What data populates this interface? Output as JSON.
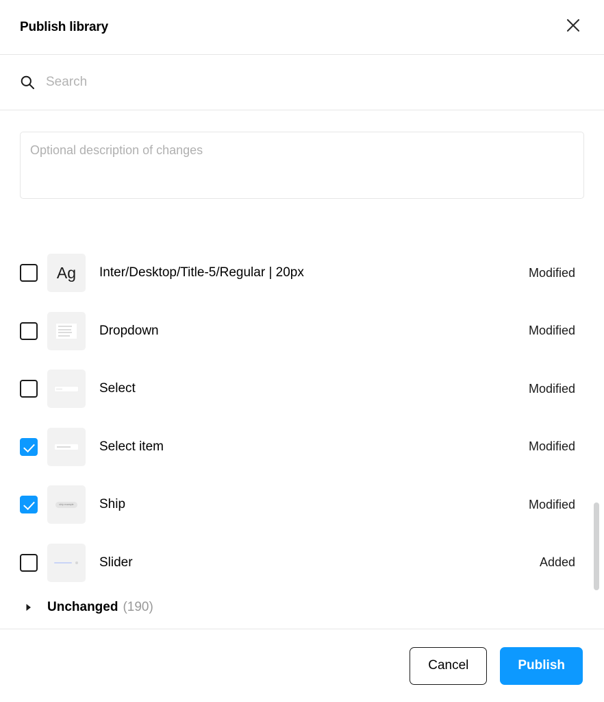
{
  "header": {
    "title": "Publish library",
    "close_icon": "close-icon"
  },
  "search": {
    "icon": "search-icon",
    "placeholder": "Search",
    "value": ""
  },
  "description": {
    "placeholder": "Optional description of changes",
    "value": ""
  },
  "items": [
    {
      "label": "Inter/Desktop/Title-5/Regular | 20px",
      "status": "Modified",
      "checked": false,
      "thumb": "typography",
      "thumb_text": "Ag"
    },
    {
      "label": "Dropdown",
      "status": "Modified",
      "checked": false,
      "thumb": "dropdown"
    },
    {
      "label": "Select",
      "status": "Modified",
      "checked": false,
      "thumb": "select"
    },
    {
      "label": "Select item",
      "status": "Modified",
      "checked": true,
      "thumb": "select-item"
    },
    {
      "label": "Ship",
      "status": "Modified",
      "checked": true,
      "thumb": "ship",
      "thumb_text": "ship example"
    },
    {
      "label": "Slider",
      "status": "Added",
      "checked": false,
      "thumb": "slider"
    }
  ],
  "unchanged_group": {
    "disclosure_icon": "triangle-right-icon",
    "label": "Unchanged",
    "count": "(190)"
  },
  "footer": {
    "cancel_label": "Cancel",
    "publish_label": "Publish"
  },
  "colors": {
    "accent": "#0d99ff",
    "border": "#e6e6e6",
    "thumb_bg": "#f2f2f2",
    "scrollbar": "#d2d3d4",
    "placeholder": "#b3b3b3"
  }
}
